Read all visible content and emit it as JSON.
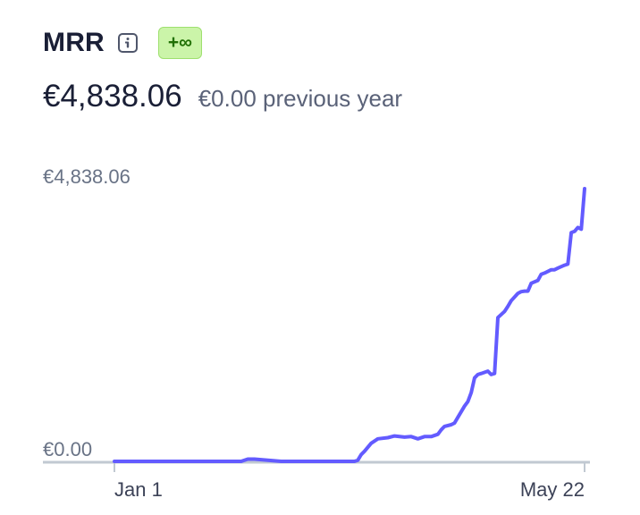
{
  "metric": {
    "title": "MRR",
    "info_icon": "info-icon",
    "badge": "+∞",
    "value": "€4,838.06",
    "previous": "€0.00 previous year"
  },
  "colors": {
    "line": "#635bff",
    "axis": "#c1c9d2",
    "badge_bg": "#cbf4a9",
    "badge_text": "#217005"
  },
  "chart_data": {
    "type": "line",
    "title": "MRR",
    "xlabel": "",
    "ylabel": "",
    "y_ticks": [
      "€4,838.06",
      "€0.00"
    ],
    "x_ticks": [
      "Jan 1",
      "May 22"
    ],
    "ylim": [
      0,
      4838.06
    ],
    "grid": false,
    "series": [
      {
        "x": [
          "Jan 1",
          "Jan 10",
          "Jan 20",
          "Jan 30",
          "Feb 8",
          "Feb 10",
          "Feb 12",
          "Feb 20",
          "Mar 1",
          "Mar 10",
          "Mar 14",
          "Mar 15",
          "Mar 16",
          "Mar 17",
          "Mar 19",
          "Mar 21",
          "Mar 24",
          "Mar 26",
          "Mar 29",
          "Mar 31",
          "Apr 2",
          "Apr 4",
          "Apr 6",
          "Apr 8",
          "Apr 9",
          "Apr 10",
          "Apr 12",
          "Apr 13",
          "Apr 14",
          "Apr 16",
          "Apr 17",
          "Apr 18",
          "Apr 19",
          "Apr 20",
          "Apr 21",
          "Apr 23",
          "Apr 24",
          "Apr 25",
          "Apr 26",
          "Apr 28",
          "Apr 29",
          "Apr 30",
          "May 2",
          "May 3",
          "May 4",
          "May 5",
          "May 6",
          "May 8",
          "May 9",
          "May 10",
          "May 12",
          "May 13",
          "May 14",
          "May 16",
          "May 17",
          "May 18",
          "May 19",
          "May 20",
          "May 21",
          "May 22"
        ],
        "y": [
          0,
          0,
          0,
          0,
          0,
          40,
          40,
          0,
          0,
          0,
          0,
          20,
          120,
          180,
          320,
          400,
          420,
          450,
          430,
          440,
          400,
          440,
          440,
          480,
          560,
          620,
          650,
          680,
          780,
          980,
          1060,
          1220,
          1480,
          1540,
          1560,
          1600,
          1540,
          1560,
          2550,
          2660,
          2750,
          2850,
          2980,
          3010,
          3020,
          3020,
          3160,
          3210,
          3320,
          3340,
          3400,
          3400,
          3430,
          3480,
          3500,
          4060,
          4080,
          4150,
          4120,
          4838.06
        ]
      }
    ]
  }
}
